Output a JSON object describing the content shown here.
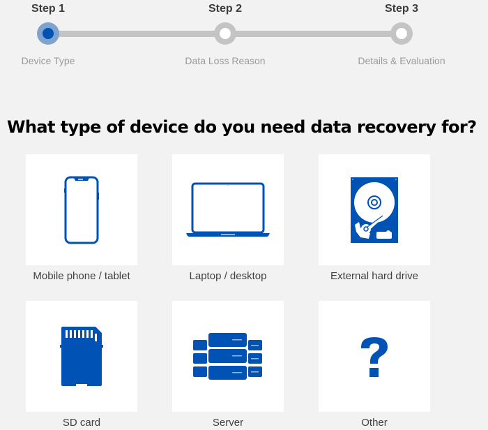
{
  "stepper": {
    "steps": [
      {
        "title": "Step 1",
        "label": "Device Type",
        "state": "active"
      },
      {
        "title": "Step 2",
        "label": "Data Loss Reason",
        "state": "inactive"
      },
      {
        "title": "Step 3",
        "label": "Details & Evaluation",
        "state": "inactive"
      }
    ]
  },
  "question": "What type of device do you need data recovery for?",
  "devices": [
    {
      "label": "Mobile phone / tablet",
      "icon": "mobile-phone-icon"
    },
    {
      "label": "Laptop / desktop",
      "icon": "laptop-icon"
    },
    {
      "label": "External hard drive",
      "icon": "hard-drive-icon"
    },
    {
      "label": "SD card",
      "icon": "sd-card-icon"
    },
    {
      "label": "Server",
      "icon": "server-icon"
    },
    {
      "label": "Other",
      "icon": "question-mark-icon"
    }
  ],
  "colors": {
    "accent": "#0052b4",
    "active_ring": "#7ea3cf",
    "inactive": "#c4c4c4",
    "background": "#f2f2f2"
  }
}
